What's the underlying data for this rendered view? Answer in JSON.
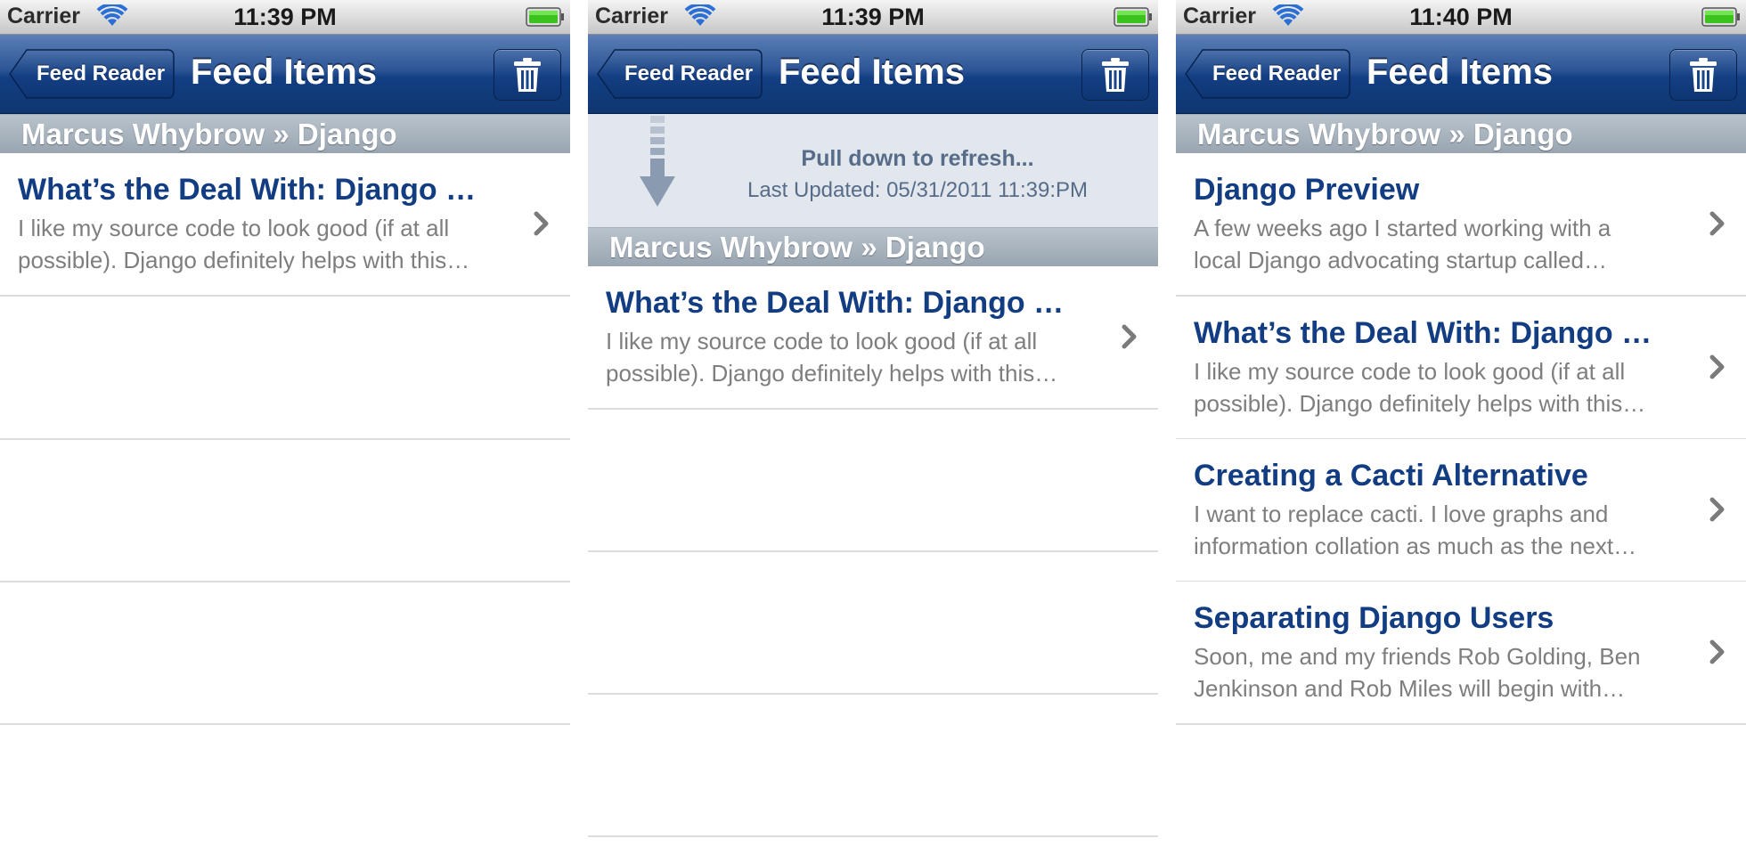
{
  "status_bar": {
    "carrier": "Carrier"
  },
  "navbar": {
    "back_label": "Feed Reader",
    "title": "Feed Items"
  },
  "feed": {
    "section_title": "Marcus Whybrow » Django"
  },
  "screens": [
    {
      "time": "11:39 PM",
      "items": [
        {
          "title": "What’s the Deal With: Django …",
          "summary_line1": "I like my source code to look good (if at all",
          "summary_line2": "possible). Django definitely helps with this…"
        }
      ]
    },
    {
      "time": "11:39 PM",
      "refresh": {
        "title": "Pull down to refresh...",
        "updated": "Last Updated: 05/31/2011 11:39:PM"
      },
      "items": [
        {
          "title": "What’s the Deal With: Django …",
          "summary_line1": "I like my source code to look good (if at all",
          "summary_line2": "possible). Django definitely helps with this…"
        }
      ]
    },
    {
      "time": "11:40 PM",
      "items": [
        {
          "title": "Django Preview",
          "summary_line1": "A few weeks ago I started working with a",
          "summary_line2": "local Django advocating startup called…"
        },
        {
          "title": "What’s the Deal With: Django …",
          "summary_line1": "I like my source code to look good (if at all",
          "summary_line2": "possible). Django definitely helps with this…"
        },
        {
          "title": "Creating a Cacti Alternative",
          "summary_line1": "I want to replace cacti. I love graphs and",
          "summary_line2": "information collation as much as the next…"
        },
        {
          "title": "Separating Django Users",
          "summary_line1": "Soon, me and my friends Rob Golding, Ben",
          "summary_line2": "Jenkinson and Rob Miles will begin with…"
        }
      ]
    }
  ],
  "icons": {
    "wifi": "wifi-icon",
    "battery": "battery-icon",
    "trash": "trash-icon",
    "chevron": "chevron-right-icon",
    "refresh_arrow": "arrow-down-icon"
  },
  "colors": {
    "nav_bar": "#123e83",
    "title_text": "#123d82",
    "summary_text": "#7e7e7e",
    "section_header": "#98a4b0",
    "refresh_bg": "#e2e7ed",
    "refresh_text": "#576c89"
  }
}
